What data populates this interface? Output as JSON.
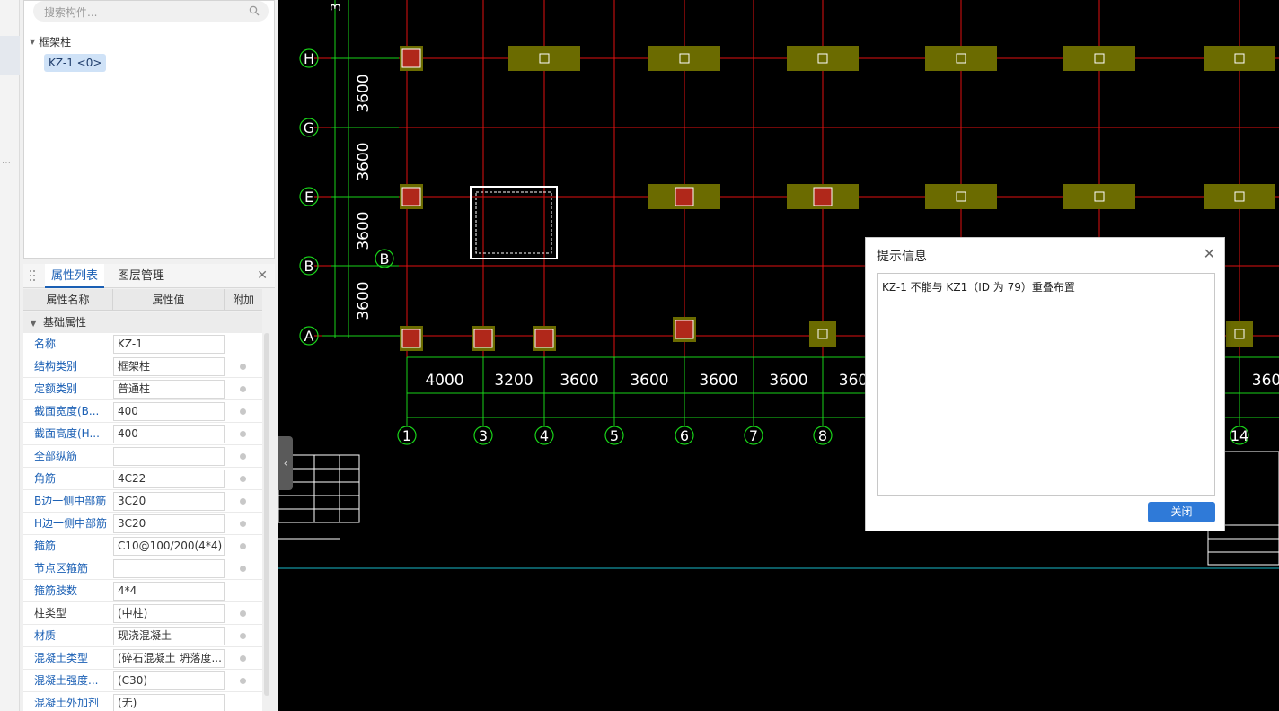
{
  "search": {
    "placeholder": "搜索构件..."
  },
  "tree": {
    "group_label": "框架柱",
    "items": [
      {
        "label": "KZ-1 <0>"
      }
    ]
  },
  "property_panel": {
    "tabs": [
      {
        "label": "属性列表"
      },
      {
        "label": "图层管理"
      }
    ],
    "headers": {
      "name": "属性名称",
      "value": "属性值",
      "extra": "附加"
    },
    "section": "基础属性",
    "rows": [
      {
        "name": "名称",
        "value": "KZ-1",
        "extra": false,
        "dark": false
      },
      {
        "name": "结构类别",
        "value": "框架柱",
        "extra": true,
        "dark": false
      },
      {
        "name": "定额类别",
        "value": "普通柱",
        "extra": true,
        "dark": false
      },
      {
        "name": "截面宽度(B...",
        "value": "400",
        "extra": true,
        "dark": false
      },
      {
        "name": "截面高度(H...",
        "value": "400",
        "extra": true,
        "dark": false
      },
      {
        "name": "全部纵筋",
        "value": "",
        "extra": true,
        "dark": false
      },
      {
        "name": "角筋",
        "value": "4C22",
        "extra": true,
        "dark": false
      },
      {
        "name": "B边一侧中部筋",
        "value": "3C20",
        "extra": true,
        "dark": false
      },
      {
        "name": "H边一侧中部筋",
        "value": "3C20",
        "extra": true,
        "dark": false
      },
      {
        "name": "箍筋",
        "value": "C10@100/200(4*4)",
        "extra": true,
        "dark": false
      },
      {
        "name": "节点区箍筋",
        "value": "",
        "extra": true,
        "dark": false
      },
      {
        "name": "箍筋肢数",
        "value": "4*4",
        "extra": false,
        "dark": false
      },
      {
        "name": "柱类型",
        "value": "(中柱)",
        "extra": true,
        "dark": true
      },
      {
        "name": "材质",
        "value": "现浇混凝土",
        "extra": true,
        "dark": false
      },
      {
        "name": "混凝土类型",
        "value": "(碎石混凝土 坍落度...",
        "extra": true,
        "dark": false
      },
      {
        "name": "混凝土强度...",
        "value": "(C30)",
        "extra": true,
        "dark": false
      },
      {
        "name": "混凝土外加剂",
        "value": "(无)",
        "extra": false,
        "dark": false
      }
    ]
  },
  "drawing": {
    "row_axes": [
      "H",
      "G",
      "E",
      "B",
      "A"
    ],
    "inner_axis_label": "B",
    "row_spacings": [
      "3600",
      "3600",
      "3600",
      "3600"
    ],
    "col_axes": [
      "1",
      "3",
      "4",
      "5",
      "6",
      "7",
      "8",
      "14"
    ],
    "col_spacings": [
      "4000",
      "3200",
      "3600",
      "3600",
      "3600",
      "3600",
      "360",
      "360"
    ],
    "top_partial_label": "3",
    "colors": {
      "grid": "#e01010",
      "dim": "#19d219",
      "column_fill": "#6b6b00",
      "column_core": "#b0281a",
      "cyan_line": "#18b8c8"
    }
  },
  "dialog": {
    "title": "提示信息",
    "message": "KZ-1 不能与 KZ1（ID 为 79）重叠布置",
    "close_button": "关闭"
  }
}
